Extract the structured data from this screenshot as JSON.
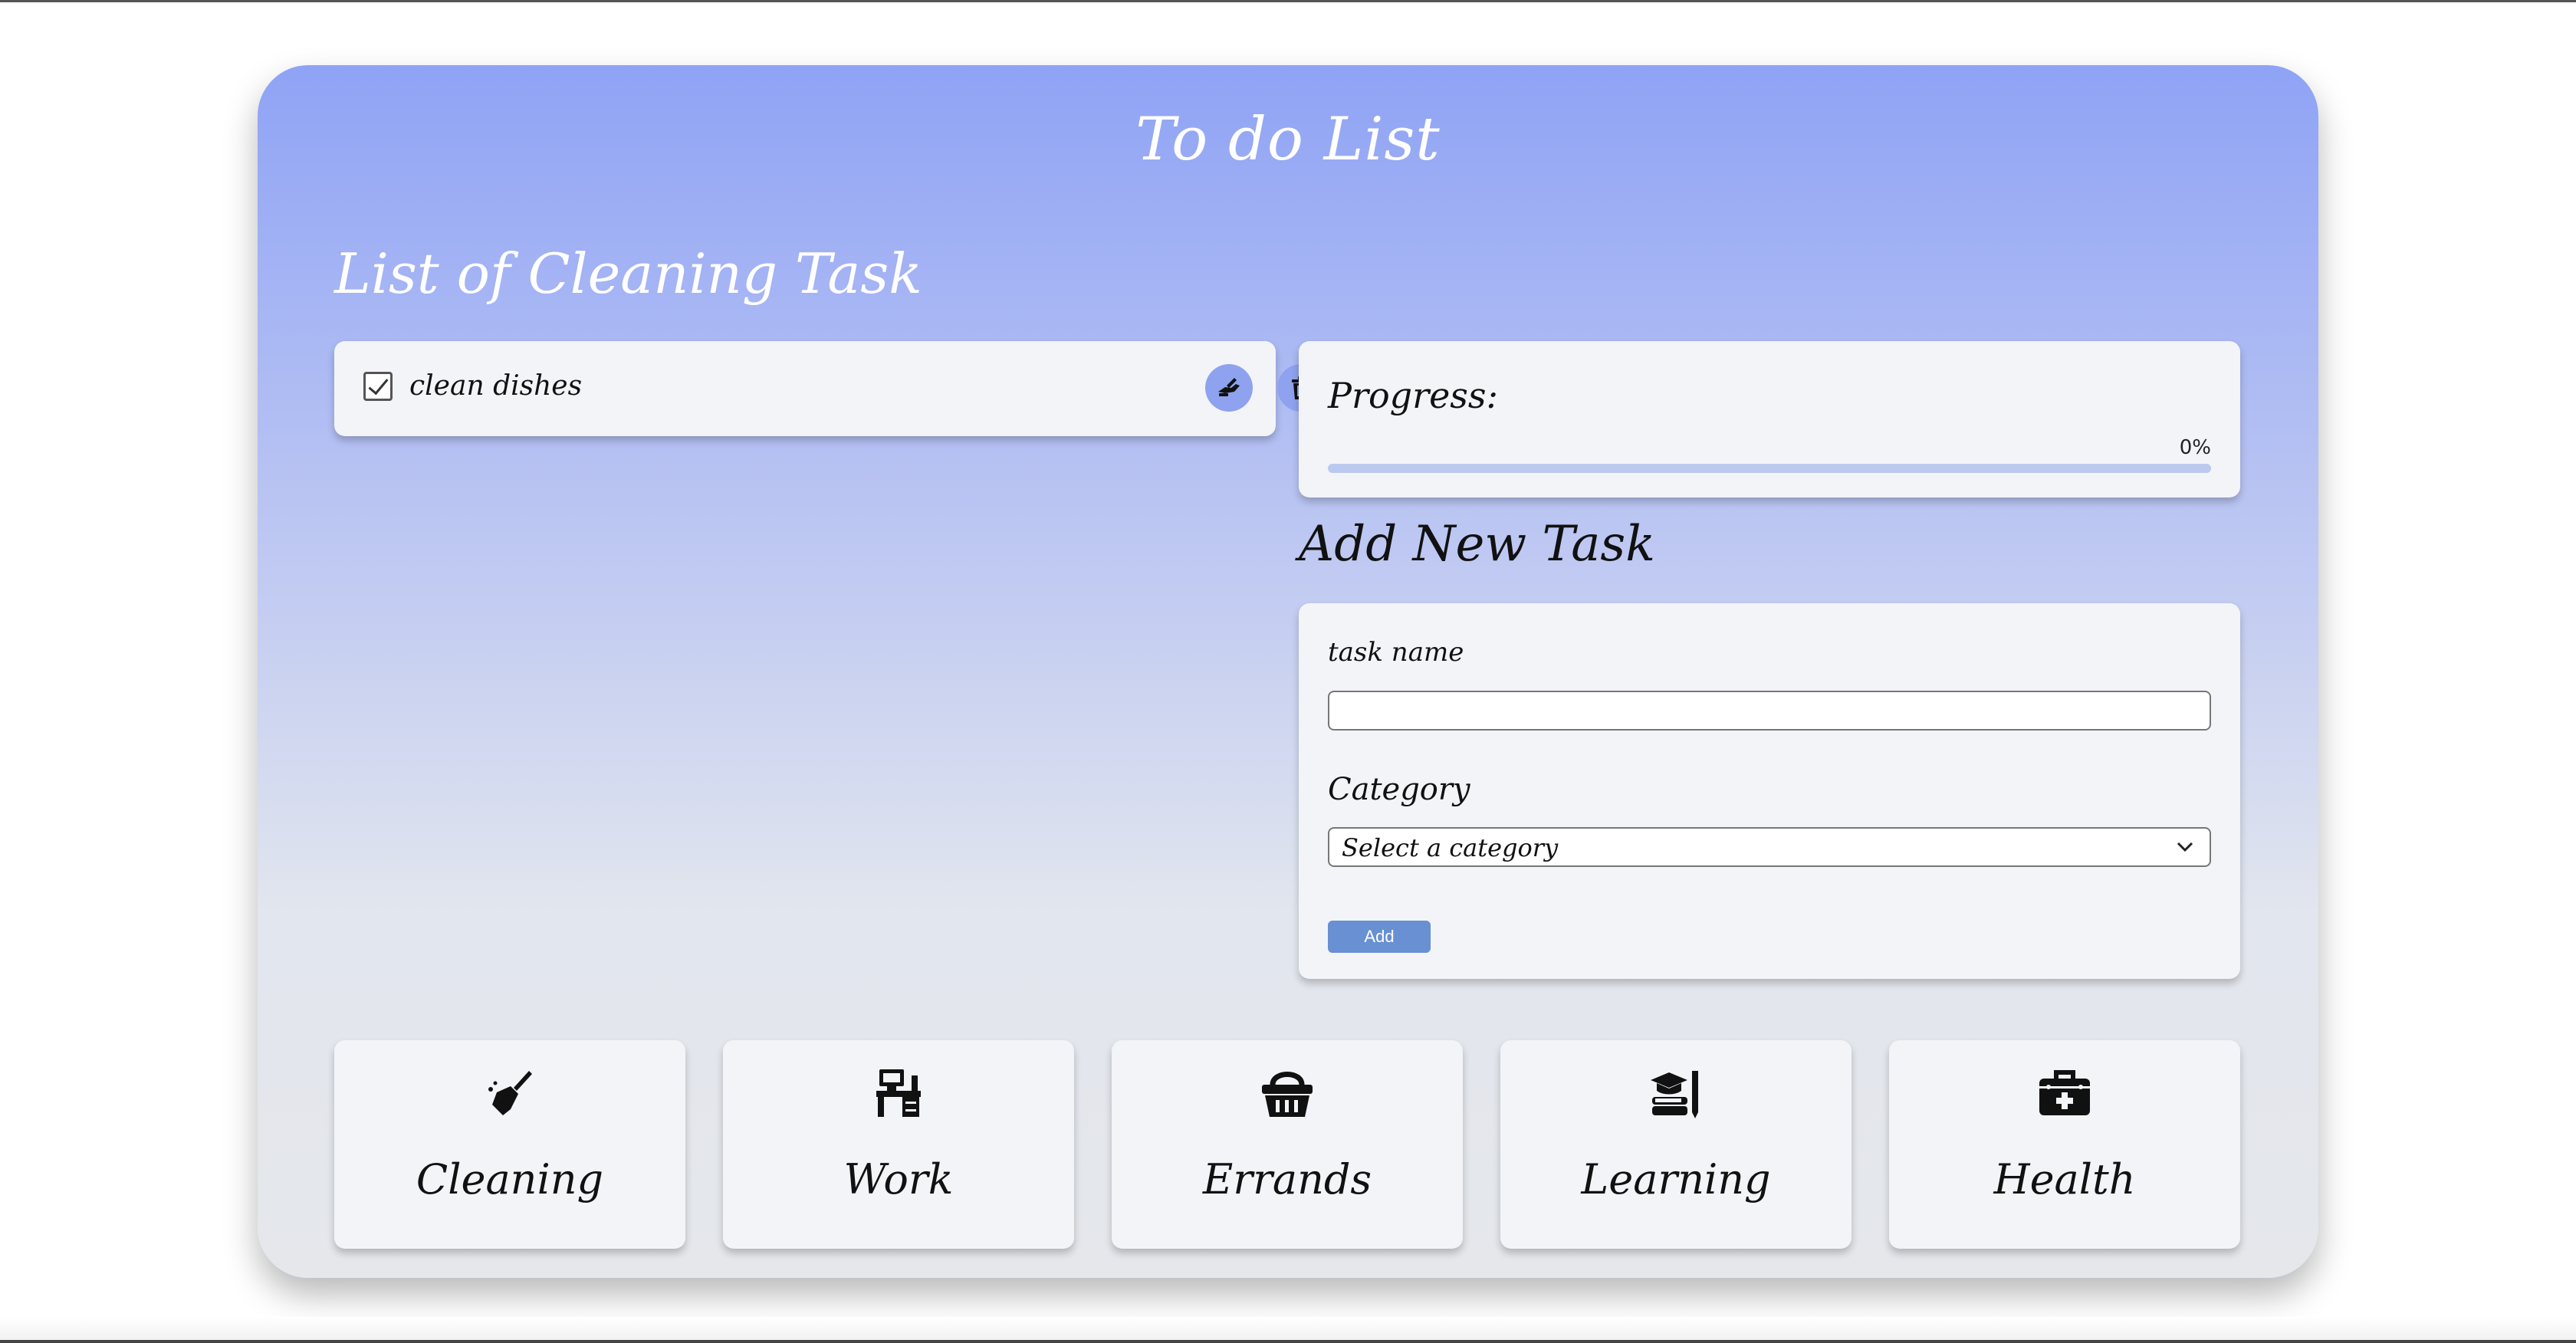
{
  "app": {
    "title": "To do List"
  },
  "task_list": {
    "title": "List of Cleaning Task",
    "tasks": [
      {
        "label": "clean dishes",
        "checked": true
      }
    ]
  },
  "progress": {
    "title": "Progress:",
    "value_text": "0%",
    "value": 0
  },
  "add_task": {
    "title": "Add New Task",
    "task_name_label": "task name",
    "task_name_value": "",
    "category_label": "Category",
    "category_selected": "Select a category",
    "add_button_label": "Add"
  },
  "categories": [
    {
      "label": "Cleaning",
      "icon": "broom-icon"
    },
    {
      "label": "Work",
      "icon": "desk-icon"
    },
    {
      "label": "Errands",
      "icon": "basket-icon"
    },
    {
      "label": "Learning",
      "icon": "graduation-books-icon"
    },
    {
      "label": "Health",
      "icon": "first-aid-kit-icon"
    }
  ],
  "colors": {
    "card_gradient_top": "#8fa3f5",
    "card_gradient_bottom": "#e5e7eb",
    "accent_button": "#6890d2",
    "circle_button": "#8ea2ef",
    "progress_track": "#bcc9ee"
  }
}
